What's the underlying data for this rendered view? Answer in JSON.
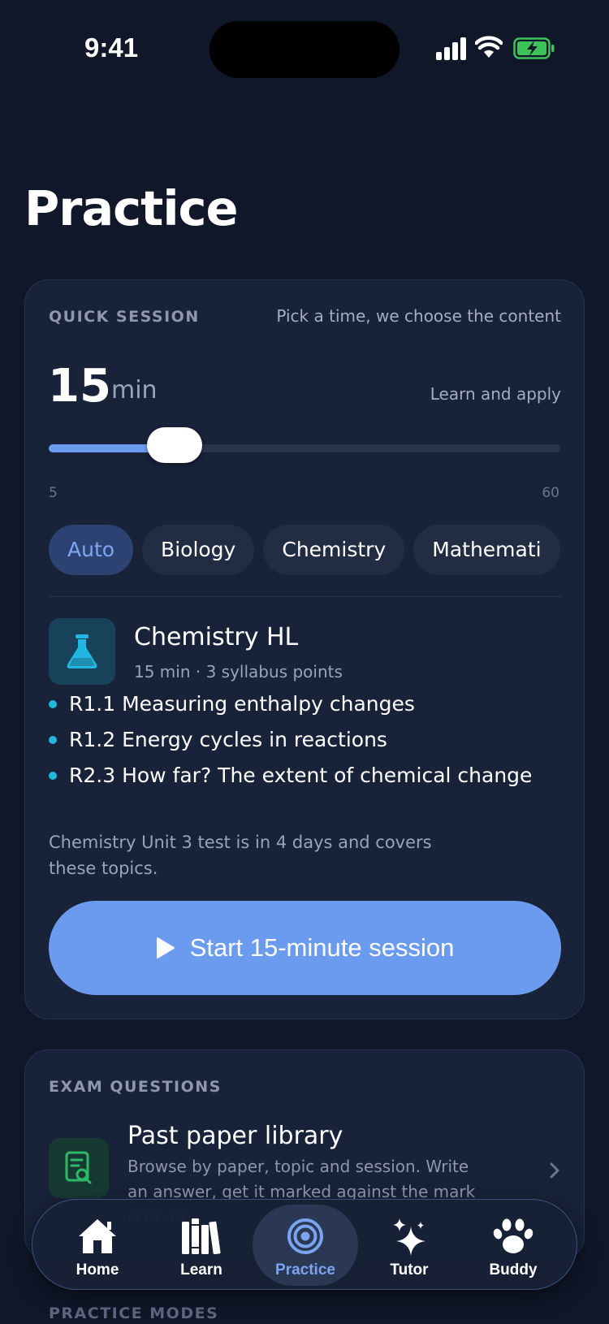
{
  "status_bar": {
    "time": "9:41"
  },
  "page": {
    "title": "Practice"
  },
  "quick_session": {
    "eyebrow": "QUICK SESSION",
    "hint": "Pick a time, we choose the content",
    "minutes": "15",
    "unit": "min",
    "mode": "Learn and apply",
    "slider": {
      "min": 5,
      "max": 60,
      "value": 15,
      "min_label": "5",
      "max_label": "60"
    },
    "chips": [
      {
        "label": "Auto",
        "active": true
      },
      {
        "label": "Biology",
        "active": false
      },
      {
        "label": "Chemistry",
        "active": false
      },
      {
        "label": "Mathemati",
        "active": false
      }
    ],
    "subject": {
      "name": "Chemistry HL",
      "meta": "15 min · 3 syllabus points",
      "icon": "flask-icon",
      "icon_color": "#22b7e0"
    },
    "topics": [
      "R1.1 Measuring enthalpy changes",
      "R1.2 Energy cycles in reactions",
      "R2.3 How far? The extent of chemical change"
    ],
    "note": "Chemistry Unit 3 test is in 4 days and covers these topics.",
    "start_label": "Start 15-minute session",
    "accent": "#6b9bee"
  },
  "exam_questions": {
    "eyebrow": "EXAM QUESTIONS",
    "item": {
      "title": "Past paper library",
      "description": "Browse by paper, topic and session. Write an answer, get it marked against the mark scheme.",
      "icon": "document-search-icon",
      "icon_color": "#2fb86a"
    }
  },
  "practice_modes": {
    "eyebrow": "PRACTICE MODES"
  },
  "tab_bar": {
    "tabs": [
      {
        "label": "Home",
        "icon": "home-icon",
        "active": false
      },
      {
        "label": "Learn",
        "icon": "books-icon",
        "active": false
      },
      {
        "label": "Practice",
        "icon": "target-icon",
        "active": true
      },
      {
        "label": "Tutor",
        "icon": "sparkles-icon",
        "active": false
      },
      {
        "label": "Buddy",
        "icon": "paw-icon",
        "active": false
      }
    ]
  }
}
